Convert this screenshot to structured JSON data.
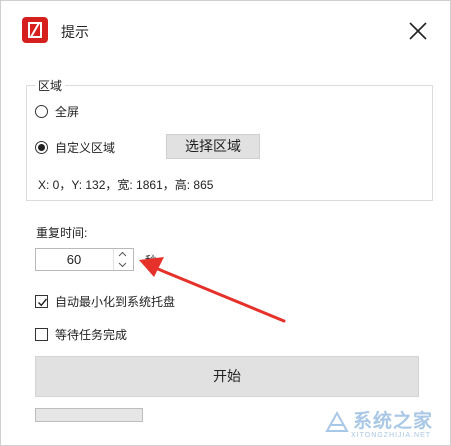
{
  "window": {
    "title": "提示",
    "close_icon": "close-icon",
    "app_icon": "app-logo-icon"
  },
  "region": {
    "legend": "区域",
    "options": [
      {
        "label": "全屏",
        "checked": false
      },
      {
        "label": "自定义区域",
        "checked": true
      }
    ],
    "select_button": "选择区域",
    "coords_text": "X: 0，Y: 132，宽: 1861，高: 865"
  },
  "repeat": {
    "label": "重复时间:",
    "value": "60",
    "unit": "秒"
  },
  "options": {
    "minimize_tray": {
      "label": "自动最小化到系统托盘",
      "checked": true
    },
    "wait_task": {
      "label": "等待任务完成",
      "checked": false
    }
  },
  "start_button": "开始",
  "progress": {
    "value": 0
  },
  "annotation": {
    "arrow_color": "#e5312a"
  },
  "watermark": {
    "text": "系统之家",
    "subtext": "XITONGZHIJIA.NET"
  }
}
